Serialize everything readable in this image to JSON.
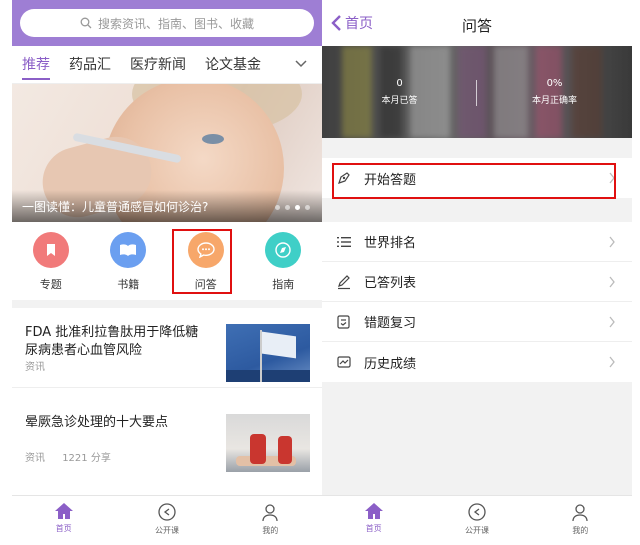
{
  "left": {
    "search": {
      "placeholder": "搜索资讯、指南、图书、收藏"
    },
    "channels": [
      "推荐",
      "药品汇",
      "医疗新闻",
      "论文基金"
    ],
    "banner": {
      "caption": "一图读懂：儿童普通感冒如何诊治?"
    },
    "shortcuts": [
      {
        "label": "专题",
        "icon": "bookmark-icon",
        "color": "#f17a7a"
      },
      {
        "label": "书籍",
        "icon": "open-book-icon",
        "color": "#6b9ff0"
      },
      {
        "label": "问答",
        "icon": "chat-bubble-icon",
        "color": "#f7a76a"
      },
      {
        "label": "指南",
        "icon": "compass-icon",
        "color": "#3fcfc7"
      }
    ],
    "news": [
      {
        "title": "FDA 批准利拉鲁肽用于降低糖尿病患者心血管风险",
        "category": "资讯",
        "shares": ""
      },
      {
        "title": "晕厥急诊处理的十大要点",
        "category": "资讯",
        "shares": "1221 分享"
      }
    ],
    "tabbar": [
      "首页",
      "公开课",
      "我的"
    ]
  },
  "right": {
    "back_label": "首页",
    "title": "问答",
    "stats": [
      {
        "value": "0",
        "label": "本月已答"
      },
      {
        "value": "0%",
        "label": "本月正确率"
      }
    ],
    "start": {
      "label": "开始答题"
    },
    "menu": [
      "世界排名",
      "已答列表",
      "错题复习",
      "历史成绩"
    ],
    "tabbar": [
      "首页",
      "公开课",
      "我的"
    ]
  },
  "colors": {
    "accent": "#8b5fc7",
    "highlight": "#e01010"
  }
}
